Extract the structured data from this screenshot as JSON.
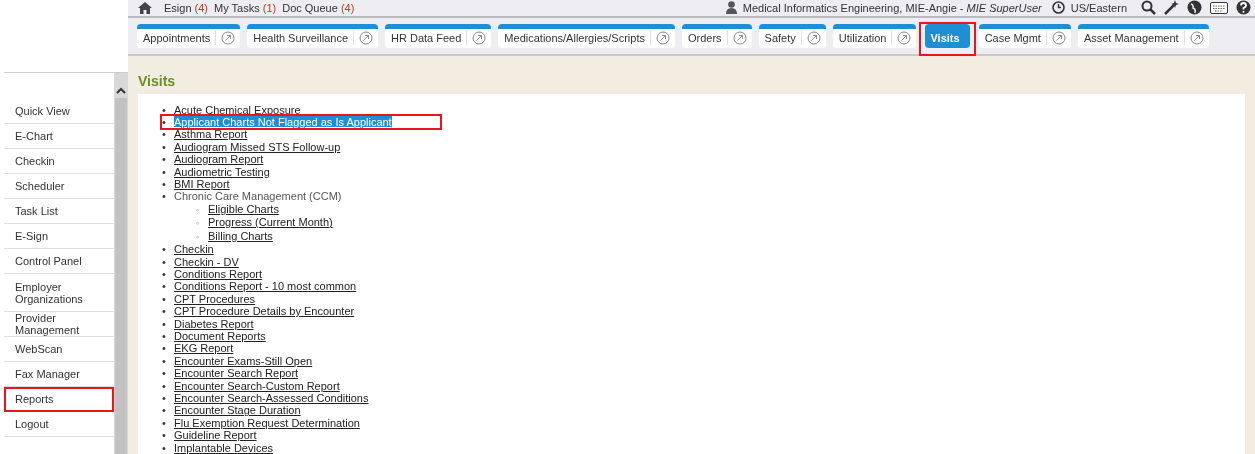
{
  "top_bar": {
    "links": [
      {
        "label": "Esign",
        "count": "(4)"
      },
      {
        "label": "My Tasks",
        "count": "(1)"
      },
      {
        "label": "Doc Queue",
        "count": "(4)"
      }
    ],
    "user": "Medical Informatics Engineering, MIE-Angie - *MIE SuperUser*",
    "timezone": "US/Eastern"
  },
  "tabs": [
    {
      "label": "Appointments",
      "selected": false,
      "annotated": false
    },
    {
      "label": "Health Surveillance",
      "selected": false,
      "annotated": false
    },
    {
      "label": "HR Data Feed",
      "selected": false,
      "annotated": false
    },
    {
      "label": "Medications/Allergies/Scripts",
      "selected": false,
      "annotated": false
    },
    {
      "label": "Orders",
      "selected": false,
      "annotated": false
    },
    {
      "label": "Safety",
      "selected": false,
      "annotated": false
    },
    {
      "label": "Utilization",
      "selected": false,
      "annotated": false
    },
    {
      "label": "Visits",
      "selected": true,
      "annotated": true
    },
    {
      "label": "Case Mgmt",
      "selected": false,
      "annotated": false
    },
    {
      "label": "Asset Management",
      "selected": false,
      "annotated": false
    }
  ],
  "sidebar": {
    "items": [
      {
        "label": "Quick View",
        "annotated": false
      },
      {
        "label": "E-Chart",
        "annotated": false
      },
      {
        "label": "Checkin",
        "annotated": false
      },
      {
        "label": "Scheduler",
        "annotated": false
      },
      {
        "label": "Task List",
        "annotated": false
      },
      {
        "label": "E-Sign",
        "annotated": false
      },
      {
        "label": "Control Panel",
        "annotated": false
      },
      {
        "label": "Employer Organizations",
        "annotated": false
      },
      {
        "label": "Provider Management",
        "annotated": false
      },
      {
        "label": "WebScan",
        "annotated": false
      },
      {
        "label": "Fax Manager",
        "annotated": false
      },
      {
        "label": "Reports",
        "annotated": true
      },
      {
        "label": "Logout",
        "annotated": false
      }
    ]
  },
  "section": {
    "title": "Visits",
    "reports": [
      {
        "bullet": "•",
        "label": "Acute Chemical Exposure",
        "link": true,
        "selected": false,
        "annotated": false
      },
      {
        "bullet": "•",
        "label": "Applicant Charts Not Flagged as Is Applicant",
        "link": true,
        "selected": true,
        "annotated": true
      },
      {
        "bullet": "•",
        "label": "Asthma Report",
        "link": true,
        "selected": false,
        "annotated": false
      },
      {
        "bullet": "•",
        "label": "Audiogram Missed STS Follow-up",
        "link": true,
        "selected": false,
        "annotated": false
      },
      {
        "bullet": "•",
        "label": "Audiogram Report",
        "link": true,
        "selected": false,
        "annotated": false
      },
      {
        "bullet": "•",
        "label": "Audiometric Testing",
        "link": true,
        "selected": false,
        "annotated": false
      },
      {
        "bullet": "•",
        "label": "BMI Report",
        "link": true,
        "selected": false,
        "annotated": false
      },
      {
        "bullet": "•",
        "label": "Chronic Care Management (CCM)",
        "link": false,
        "selected": false,
        "annotated": false,
        "children": [
          {
            "bullet": "◦",
            "label": "Eligible Charts",
            "link": true,
            "selected": false,
            "annotated": false
          },
          {
            "bullet": "◦",
            "label": "Progress (Current Month)",
            "link": true,
            "selected": false,
            "annotated": false
          },
          {
            "bullet": "◦",
            "label": "Billing Charts",
            "link": true,
            "selected": false,
            "annotated": false
          }
        ]
      },
      {
        "bullet": "•",
        "label": "Checkin",
        "link": true,
        "selected": false,
        "annotated": false
      },
      {
        "bullet": "•",
        "label": "Checkin - DV",
        "link": true,
        "selected": false,
        "annotated": false
      },
      {
        "bullet": "•",
        "label": "Conditions Report",
        "link": true,
        "selected": false,
        "annotated": false
      },
      {
        "bullet": "•",
        "label": "Conditions Report - 10 most common",
        "link": true,
        "selected": false,
        "annotated": false
      },
      {
        "bullet": "•",
        "label": "CPT Procedures",
        "link": true,
        "selected": false,
        "annotated": false
      },
      {
        "bullet": "•",
        "label": "CPT Procedure Details by Encounter",
        "link": true,
        "selected": false,
        "annotated": false
      },
      {
        "bullet": "•",
        "label": "Diabetes Report",
        "link": true,
        "selected": false,
        "annotated": false
      },
      {
        "bullet": "•",
        "label": "Document Reports",
        "link": true,
        "selected": false,
        "annotated": false
      },
      {
        "bullet": "•",
        "label": "EKG Report",
        "link": true,
        "selected": false,
        "annotated": false
      },
      {
        "bullet": "•",
        "label": "Encounter Exams-Still Open",
        "link": true,
        "selected": false,
        "annotated": false
      },
      {
        "bullet": "•",
        "label": "Encounter Search Report",
        "link": true,
        "selected": false,
        "annotated": false
      },
      {
        "bullet": "•",
        "label": "Encounter Search-Custom Report",
        "link": true,
        "selected": false,
        "annotated": false
      },
      {
        "bullet": "•",
        "label": "Encounter Search-Assessed Conditions",
        "link": true,
        "selected": false,
        "annotated": false
      },
      {
        "bullet": "•",
        "label": "Encounter Stage Duration",
        "link": true,
        "selected": false,
        "annotated": false
      },
      {
        "bullet": "•",
        "label": "Flu Exemption Request Determination",
        "link": true,
        "selected": false,
        "annotated": false
      },
      {
        "bullet": "•",
        "label": "Guideline Report",
        "link": true,
        "selected": false,
        "annotated": false
      },
      {
        "bullet": "•",
        "label": "Implantable Devices",
        "link": true,
        "selected": false,
        "annotated": false
      }
    ]
  }
}
